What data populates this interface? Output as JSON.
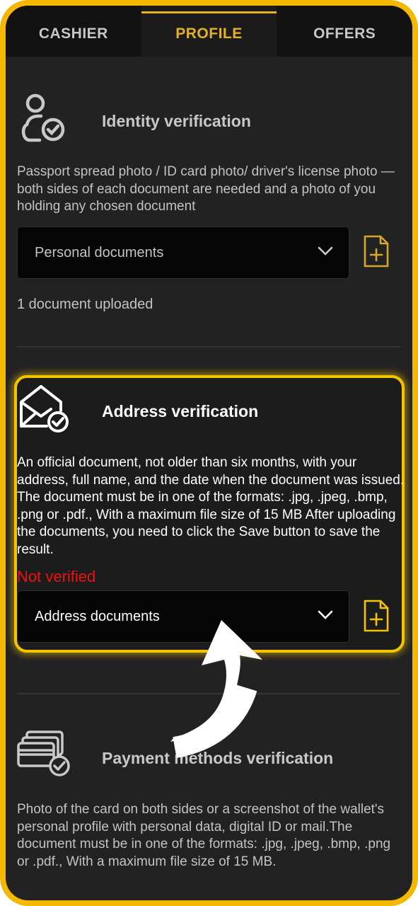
{
  "tabs": [
    {
      "label": "CASHIER",
      "active": false
    },
    {
      "label": "PROFILE",
      "active": true
    },
    {
      "label": "OFFERS",
      "active": false
    }
  ],
  "identity": {
    "title": "Identity verification",
    "description": "Passport spread photo / ID card photo/ driver's license photo — both sides of each document are needed and a photo of you holding any chosen document",
    "select_value": "Personal documents",
    "uploaded_text": "1 document uploaded"
  },
  "address": {
    "title": "Address verification",
    "description": "An official document, not older than six months, with your address, full name, and the date when the document was issued. The document must be in one of the formats: .jpg, .jpeg, .bmp, .png or .pdf., With a maximum file size of 15 MB After uploading the documents, you need to click the Save button to save the result.",
    "status": "Not verified",
    "select_value": "Address documents"
  },
  "payment": {
    "title": "Payment methods verification",
    "description": "Photo of the card on both sides or a screenshot of the wallet's personal profile with personal data, digital ID or mail.The document must be in one of the formats: .jpg, .jpeg, .bmp, .png or .pdf., With a maximum file size of 15 MB."
  },
  "colors": {
    "accent": "#e2b128",
    "frame": "#f5b800",
    "status_red": "#ee1111",
    "background": "#222222"
  },
  "icons": [
    "user-check-icon",
    "envelope-check-icon",
    "cards-check-icon",
    "file-plus-icon",
    "chevron-down-icon",
    "curved-arrow-pointer"
  ]
}
